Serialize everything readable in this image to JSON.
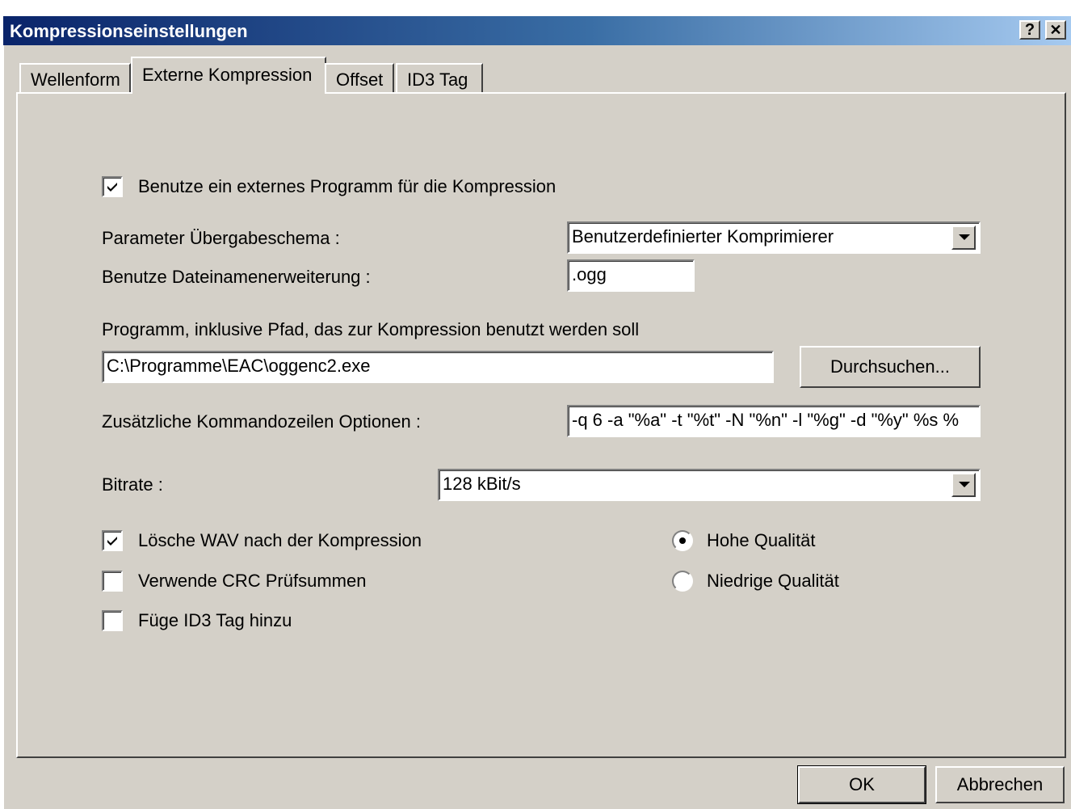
{
  "window": {
    "title": "Kompressionseinstellungen",
    "help_label": "?",
    "close_label": "✕"
  },
  "tabs": [
    {
      "label": "Wellenform"
    },
    {
      "label": "Externe Kompression"
    },
    {
      "label": "Offset"
    },
    {
      "label": "ID3 Tag"
    }
  ],
  "settings": {
    "use_external_label": "Benutze ein externes Programm für die Kompression",
    "use_external_checked": true,
    "param_scheme_label": "Parameter Übergabeschema :",
    "param_scheme_value": "Benutzerdefinierter Komprimierer",
    "extension_label": "Benutze Dateinamenerweiterung :",
    "extension_value": ".ogg",
    "program_path_label": "Programm, inklusive Pfad, das zur Kompression benutzt werden soll",
    "program_path_value": "C:\\Programme\\EAC\\oggenc2.exe",
    "browse_label": "Durchsuchen...",
    "cmd_options_label": "Zusätzliche Kommandozeilen Optionen :",
    "cmd_options_value": "-q 6 -a \"%a\" -t \"%t\" -N \"%n\" -l \"%g\" -d \"%y\" %s %",
    "bitrate_label": "Bitrate :",
    "bitrate_value": "128 kBit/s",
    "delete_wav_label": "Lösche WAV nach der Kompression",
    "delete_wav_checked": true,
    "use_crc_label": "Verwende CRC Prüfsummen",
    "use_crc_checked": false,
    "add_id3_label": "Füge ID3 Tag hinzu",
    "add_id3_checked": false,
    "high_quality_label": "Hohe Qualität",
    "high_quality_selected": true,
    "low_quality_label": "Niedrige Qualität",
    "low_quality_selected": false
  },
  "footer": {
    "ok_label": "OK",
    "cancel_label": "Abbrechen"
  }
}
